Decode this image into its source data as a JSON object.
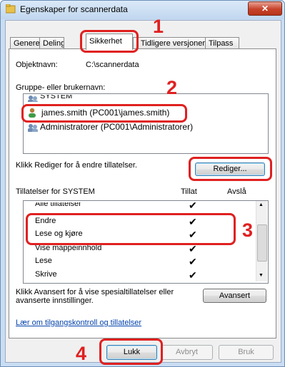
{
  "window": {
    "title": "Egenskaper for scannerdata",
    "close_glyph": "✕"
  },
  "tabs": [
    {
      "label": "Generelt"
    },
    {
      "label": "Deling"
    },
    {
      "label": "Sikkerhet"
    },
    {
      "label": "Tidligere versjoner"
    },
    {
      "label": "Tilpass"
    }
  ],
  "security": {
    "object_label": "Objektnavn:",
    "object_value": "C:\\scannerdata",
    "groups_label": "Gruppe- eller brukernavn:",
    "groups": [
      {
        "name": "SYSTEM",
        "icon": "group-icon"
      },
      {
        "name": "james.smith (PC001\\james.smith)",
        "icon": "user-icon"
      },
      {
        "name": "Administratorer (PC001\\Administratorer)",
        "icon": "group-icon"
      }
    ],
    "edit_hint": "Klikk Rediger for å endre tillatelser.",
    "edit_button": "Rediger...",
    "permissions_header": "Tillatelser for SYSTEM",
    "allow_header": "Tillat",
    "deny_header": "Avslå",
    "permissions": [
      {
        "name": "Alle tillatelser",
        "allow": "✔",
        "deny": ""
      },
      {
        "name": "Endre",
        "allow": "✔",
        "deny": ""
      },
      {
        "name": "Lese og kjøre",
        "allow": "✔",
        "deny": ""
      },
      {
        "name": "Vise mappeinnhold",
        "allow": "✔",
        "deny": ""
      },
      {
        "name": "Lese",
        "allow": "✔",
        "deny": ""
      },
      {
        "name": "Skrive",
        "allow": "✔",
        "deny": ""
      }
    ],
    "advanced_hint_line1": "Klikk Avansert for å vise spesialtillatelser eller",
    "advanced_hint_line2": "avanserte innstillinger.",
    "advanced_button": "Avansert",
    "help_link": "Lær om tilgangskontroll og tillatelser"
  },
  "footer": {
    "ok_button": "Lukk",
    "cancel_button": "Avbryt",
    "apply_button": "Bruk"
  },
  "callouts": [
    "1",
    "2",
    "3",
    "4"
  ],
  "colors": {
    "callout": "#e02020",
    "link": "#0645ad"
  }
}
